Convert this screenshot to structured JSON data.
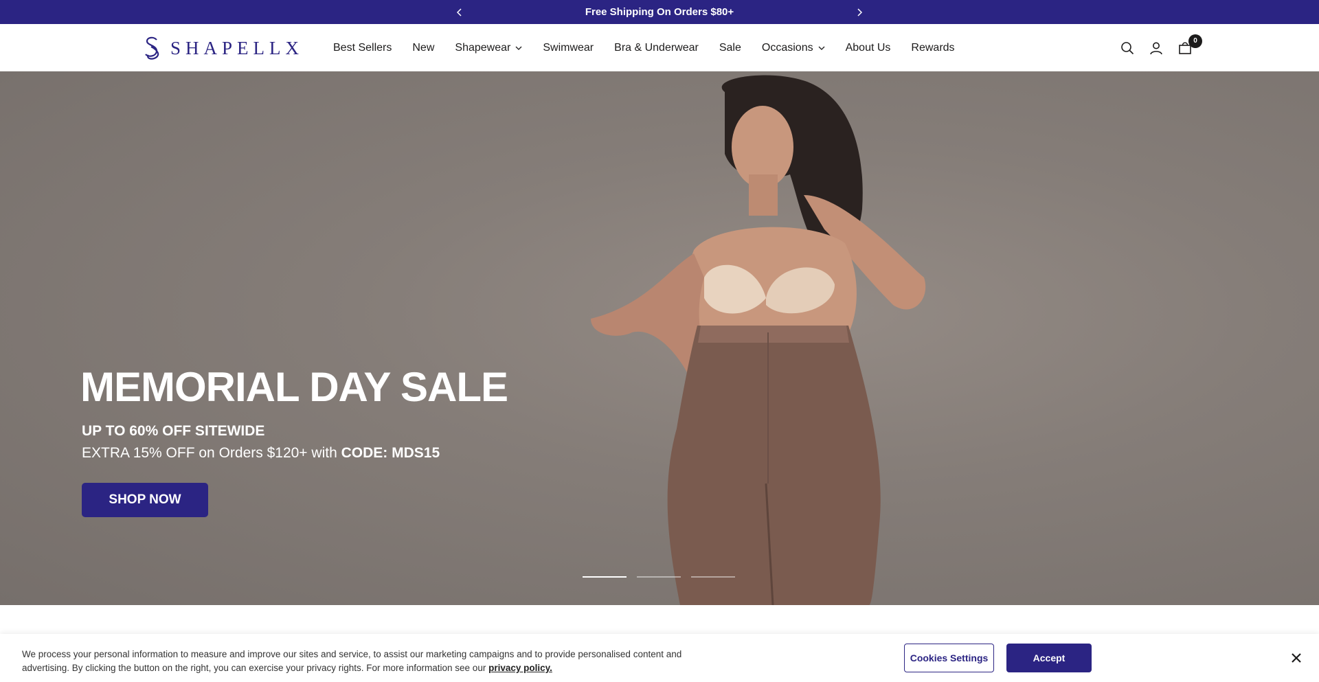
{
  "announcement": {
    "text": "Free Shipping On Orders $80+",
    "prev_icon": "chevron-left-icon",
    "next_icon": "chevron-right-icon"
  },
  "header": {
    "logo_text": "SHAPELLX",
    "nav": [
      {
        "label": "Best Sellers",
        "has_dropdown": false
      },
      {
        "label": "New",
        "has_dropdown": false
      },
      {
        "label": "Shapewear",
        "has_dropdown": true
      },
      {
        "label": "Swimwear",
        "has_dropdown": false
      },
      {
        "label": "Bra & Underwear",
        "has_dropdown": false
      },
      {
        "label": "Sale",
        "has_dropdown": false
      },
      {
        "label": "Occasions",
        "has_dropdown": true
      },
      {
        "label": "About Us",
        "has_dropdown": false
      },
      {
        "label": "Rewards",
        "has_dropdown": false
      }
    ],
    "icons": [
      "search-icon",
      "account-icon",
      "cart-icon"
    ],
    "cart_count": "0"
  },
  "hero": {
    "title": "MEMORIAL DAY SALE",
    "subtitle_1": "UP TO 60% OFF SITEWIDE",
    "subtitle_2_prefix": "EXTRA 15% OFF on Orders $120+ with ",
    "subtitle_2_code": "CODE: MDS15",
    "cta": "SHOP NOW",
    "slides_total": 3,
    "active_slide": 1
  },
  "cookie_banner": {
    "text": "We process your personal information to measure and improve our sites and service, to assist our marketing campaigns and to provide personalised content and advertising. By clicking the button on the right, you can exercise your privacy rights. For more information see our ",
    "link_text": "privacy policy.",
    "settings_label": "Cookies Settings",
    "accept_label": "Accept",
    "close_icon": "close-icon"
  },
  "colors": {
    "brand": "#2b2483",
    "text": "#1c1b1b",
    "hero_background": "#857d78"
  }
}
